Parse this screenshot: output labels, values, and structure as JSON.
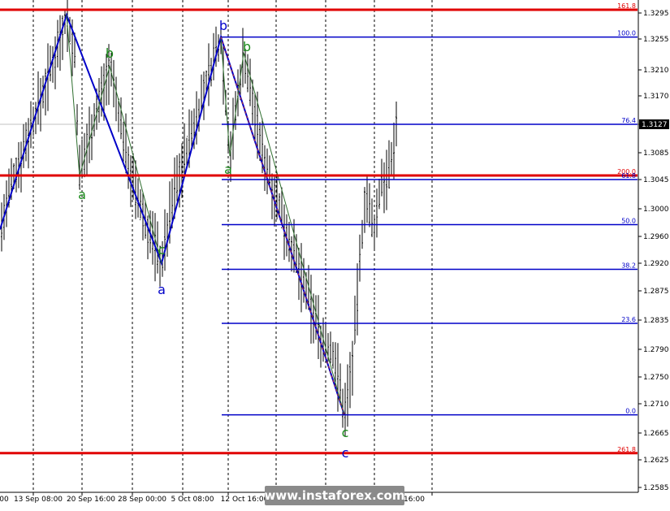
{
  "chart_data": {
    "type": "candlestick",
    "symbol_current_price": "1.3127",
    "y_ticks": [
      "1.3295",
      "1.3255",
      "1.3210",
      "1.3170",
      "1.3127",
      "1.3085",
      "1.3045",
      "1.3000",
      "1.2960",
      "1.2920",
      "1.2875",
      "1.2835",
      "1.2790",
      "1.2750",
      "1.2710",
      "1.2665",
      "1.2625",
      "1.2585"
    ],
    "ylim": [
      1.258,
      1.331
    ],
    "x_ticks": [
      "00",
      "13 Sep 08:00",
      "20 Sep 16:00",
      "28 Sep 00:00",
      "5 Oct 08:00",
      "12 Oct 16:00",
      "",
      "",
      "16:00"
    ],
    "fib_levels": [
      {
        "label": "161.8",
        "price": 1.33,
        "color": "#e00000"
      },
      {
        "label": "100.0",
        "price": 1.3258,
        "color": "#0000c8"
      },
      {
        "label": "76.4",
        "price": 1.3127,
        "color": "#0000c8"
      },
      {
        "label": "200.0",
        "price": 1.3051,
        "color": "#e00000"
      },
      {
        "label": "61.8",
        "price": 1.3045,
        "color": "#0000c8"
      },
      {
        "label": "50.0",
        "price": 1.2977,
        "color": "#0000c8"
      },
      {
        "label": "38.2",
        "price": 1.291,
        "color": "#0000c8"
      },
      {
        "label": "23.6",
        "price": 1.283,
        "color": "#0000c8"
      },
      {
        "label": "0.0",
        "price": 1.2693,
        "color": "#0000c8"
      },
      {
        "label": "261.8",
        "price": 1.2635,
        "color": "#e00000"
      }
    ],
    "wave_labels": [
      {
        "text": "a",
        "color": "#1a8a1a"
      },
      {
        "text": "b",
        "color": "#1a8a1a"
      },
      {
        "text": "c",
        "color": "#1a8a1a"
      },
      {
        "text": "a",
        "color": "#0000c8"
      },
      {
        "text": "b",
        "color": "#0000c8"
      },
      {
        "text": "a",
        "color": "#1a8a1a"
      },
      {
        "text": "b",
        "color": "#1a8a1a"
      },
      {
        "text": "c",
        "color": "#1a8a1a"
      },
      {
        "text": "c",
        "color": "#0000c8"
      }
    ],
    "colors": {
      "grid": "#000000",
      "bars": "#000000",
      "accent_red": "#e00000",
      "accent_blue": "#0000c8",
      "accent_green": "#1a8a1a",
      "price_box": "#000000"
    }
  },
  "watermark": "www.instaforex.com"
}
